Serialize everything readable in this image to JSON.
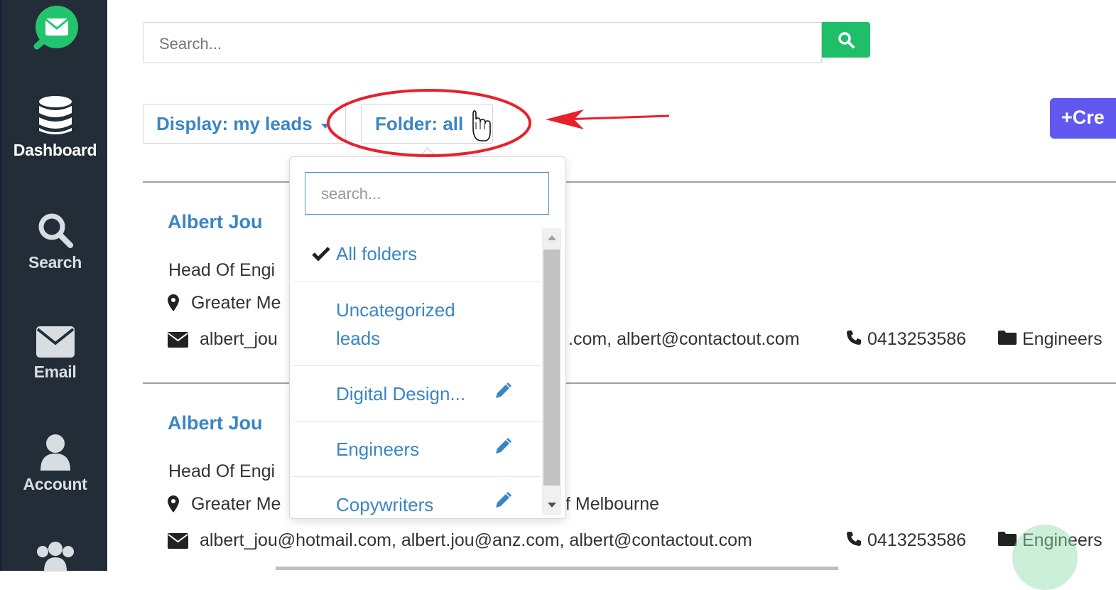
{
  "sidebar": {
    "items": [
      {
        "label": "Dashboard"
      },
      {
        "label": "Search"
      },
      {
        "label": "Email"
      },
      {
        "label": "Account"
      }
    ]
  },
  "search": {
    "placeholder": "Search..."
  },
  "filters": {
    "display_label": "Display: my leads",
    "folder_label": "Folder: all",
    "create_label": "Cre"
  },
  "folder_dropdown": {
    "search_placeholder": "search...",
    "items": [
      {
        "label": "All folders",
        "selected": true
      },
      {
        "label": "Uncategorized leads",
        "line1": "Uncategorized",
        "line2": "leads"
      },
      {
        "label": "Digital Design...",
        "editable": true
      },
      {
        "label": "Engineers",
        "editable": true
      },
      {
        "label": "Copywriters",
        "editable": true
      }
    ]
  },
  "leads": [
    {
      "name": "Albert Jou",
      "title": "Head Of Engi",
      "location": "Greater Me",
      "emails_left": "albert_jou",
      "emails_right": ".com, albert@contactout.com",
      "phone": "0413253586",
      "folder": "Engineers"
    },
    {
      "name": "Albert Jou",
      "title": "Head Of Engi",
      "location": "Greater Me",
      "location_tail": "f Melbourne",
      "emails": "albert_jou@hotmail.com, albert.jou@anz.com, albert@contactout.com",
      "phone": "0413253586",
      "folder": "Engineers"
    }
  ],
  "colors": {
    "sidebar_bg": "#222d37",
    "brand_green": "#1fbf6a",
    "link_blue": "#3a86c4",
    "create_purple": "#6158f0",
    "annotation_red": "#e8202a"
  }
}
